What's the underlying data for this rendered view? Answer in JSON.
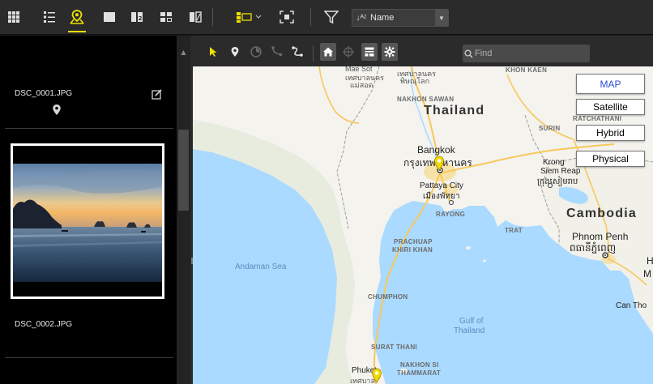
{
  "toolbar": {
    "sort": {
      "label": "Name",
      "glyph": "↓ᴬᶻ"
    },
    "icons": [
      "grid-view-icon",
      "list-view-icon",
      "map-view-icon",
      "single-view-icon",
      "two-up-view-icon",
      "compare-view-icon",
      "split-view-icon",
      "panel-layout-icon",
      "fullscreen-icon",
      "filter-icon"
    ],
    "accent": "#f0e000"
  },
  "thumbnails": [
    {
      "filename": "DSC_0001.JPG",
      "has_location": true,
      "edited": true
    },
    {
      "filename": "DSC_0002.JPG",
      "has_location": false,
      "selected": true
    }
  ],
  "map_toolbar": {
    "find_placeholder": "Find",
    "icons": [
      "select-arrow-icon",
      "place-pin-icon",
      "track-log-icon",
      "route-icon",
      "path-edit-icon",
      "home-icon",
      "locate-icon",
      "info-panel-icon",
      "settings-icon"
    ]
  },
  "map": {
    "type_buttons": [
      {
        "label": "MAP",
        "active": true
      },
      {
        "label": "Satellite",
        "active": false
      },
      {
        "label": "Hybrid",
        "active": false
      },
      {
        "label": "Physical",
        "active": false
      }
    ],
    "labels": {
      "mae_sot": "Mae Sot",
      "phitsanulok_thai": "เทศบาลนคร",
      "phitsanulok_thai2": "พิษณุโลก",
      "mae_sot_thai": "เทศบาลนคร",
      "mae_sot_thai2": "แม่สอด",
      "khon_kaen": "KHON KAEN",
      "nakhon_sawan": "NAKHON SAWAN",
      "thailand": "Thailand",
      "ratchathani": "RATCHATHANI",
      "surin": "SURIN",
      "bangkok": "Bangkok",
      "bangkok_thai": "กรุงเทพมหานคร",
      "pattaya": "Pattaya City",
      "pattaya_thai": "เมืองพัทยา",
      "rayong": "RAYONG",
      "trat": "TRAT",
      "krong": "Krong",
      "siem_reap": "Siem Reap",
      "siem_reap_khmer": "ក្រុងសៀមរាប",
      "cambodia": "Cambodia",
      "phnom_penh": "Phnom Penh",
      "phnom_penh_khmer": "ពធានីភ្នំពេញ",
      "prachuap": "PRACHUAP",
      "khiri_khan": "KHIRI KHAN",
      "andaman_sea": "Andaman Sea",
      "chumphon": "CHUMPHON",
      "gulf": "Gulf of",
      "gulf2": "Thailand",
      "can_tho": "Can Tho",
      "surat_thani": "SURAT THANI",
      "nakhon_si": "NAKHON SI",
      "thammarat": "THAMMARAT",
      "phuket": "Phuket",
      "phuket_thai": "เทศบาล",
      "edge_h": "H",
      "edge_m": "M"
    },
    "colors": {
      "land": "#f4f3ee",
      "water": "#aadaff",
      "urban": "#f7d88a",
      "marker": "#f5d800",
      "highway": "#f8c85c"
    }
  }
}
